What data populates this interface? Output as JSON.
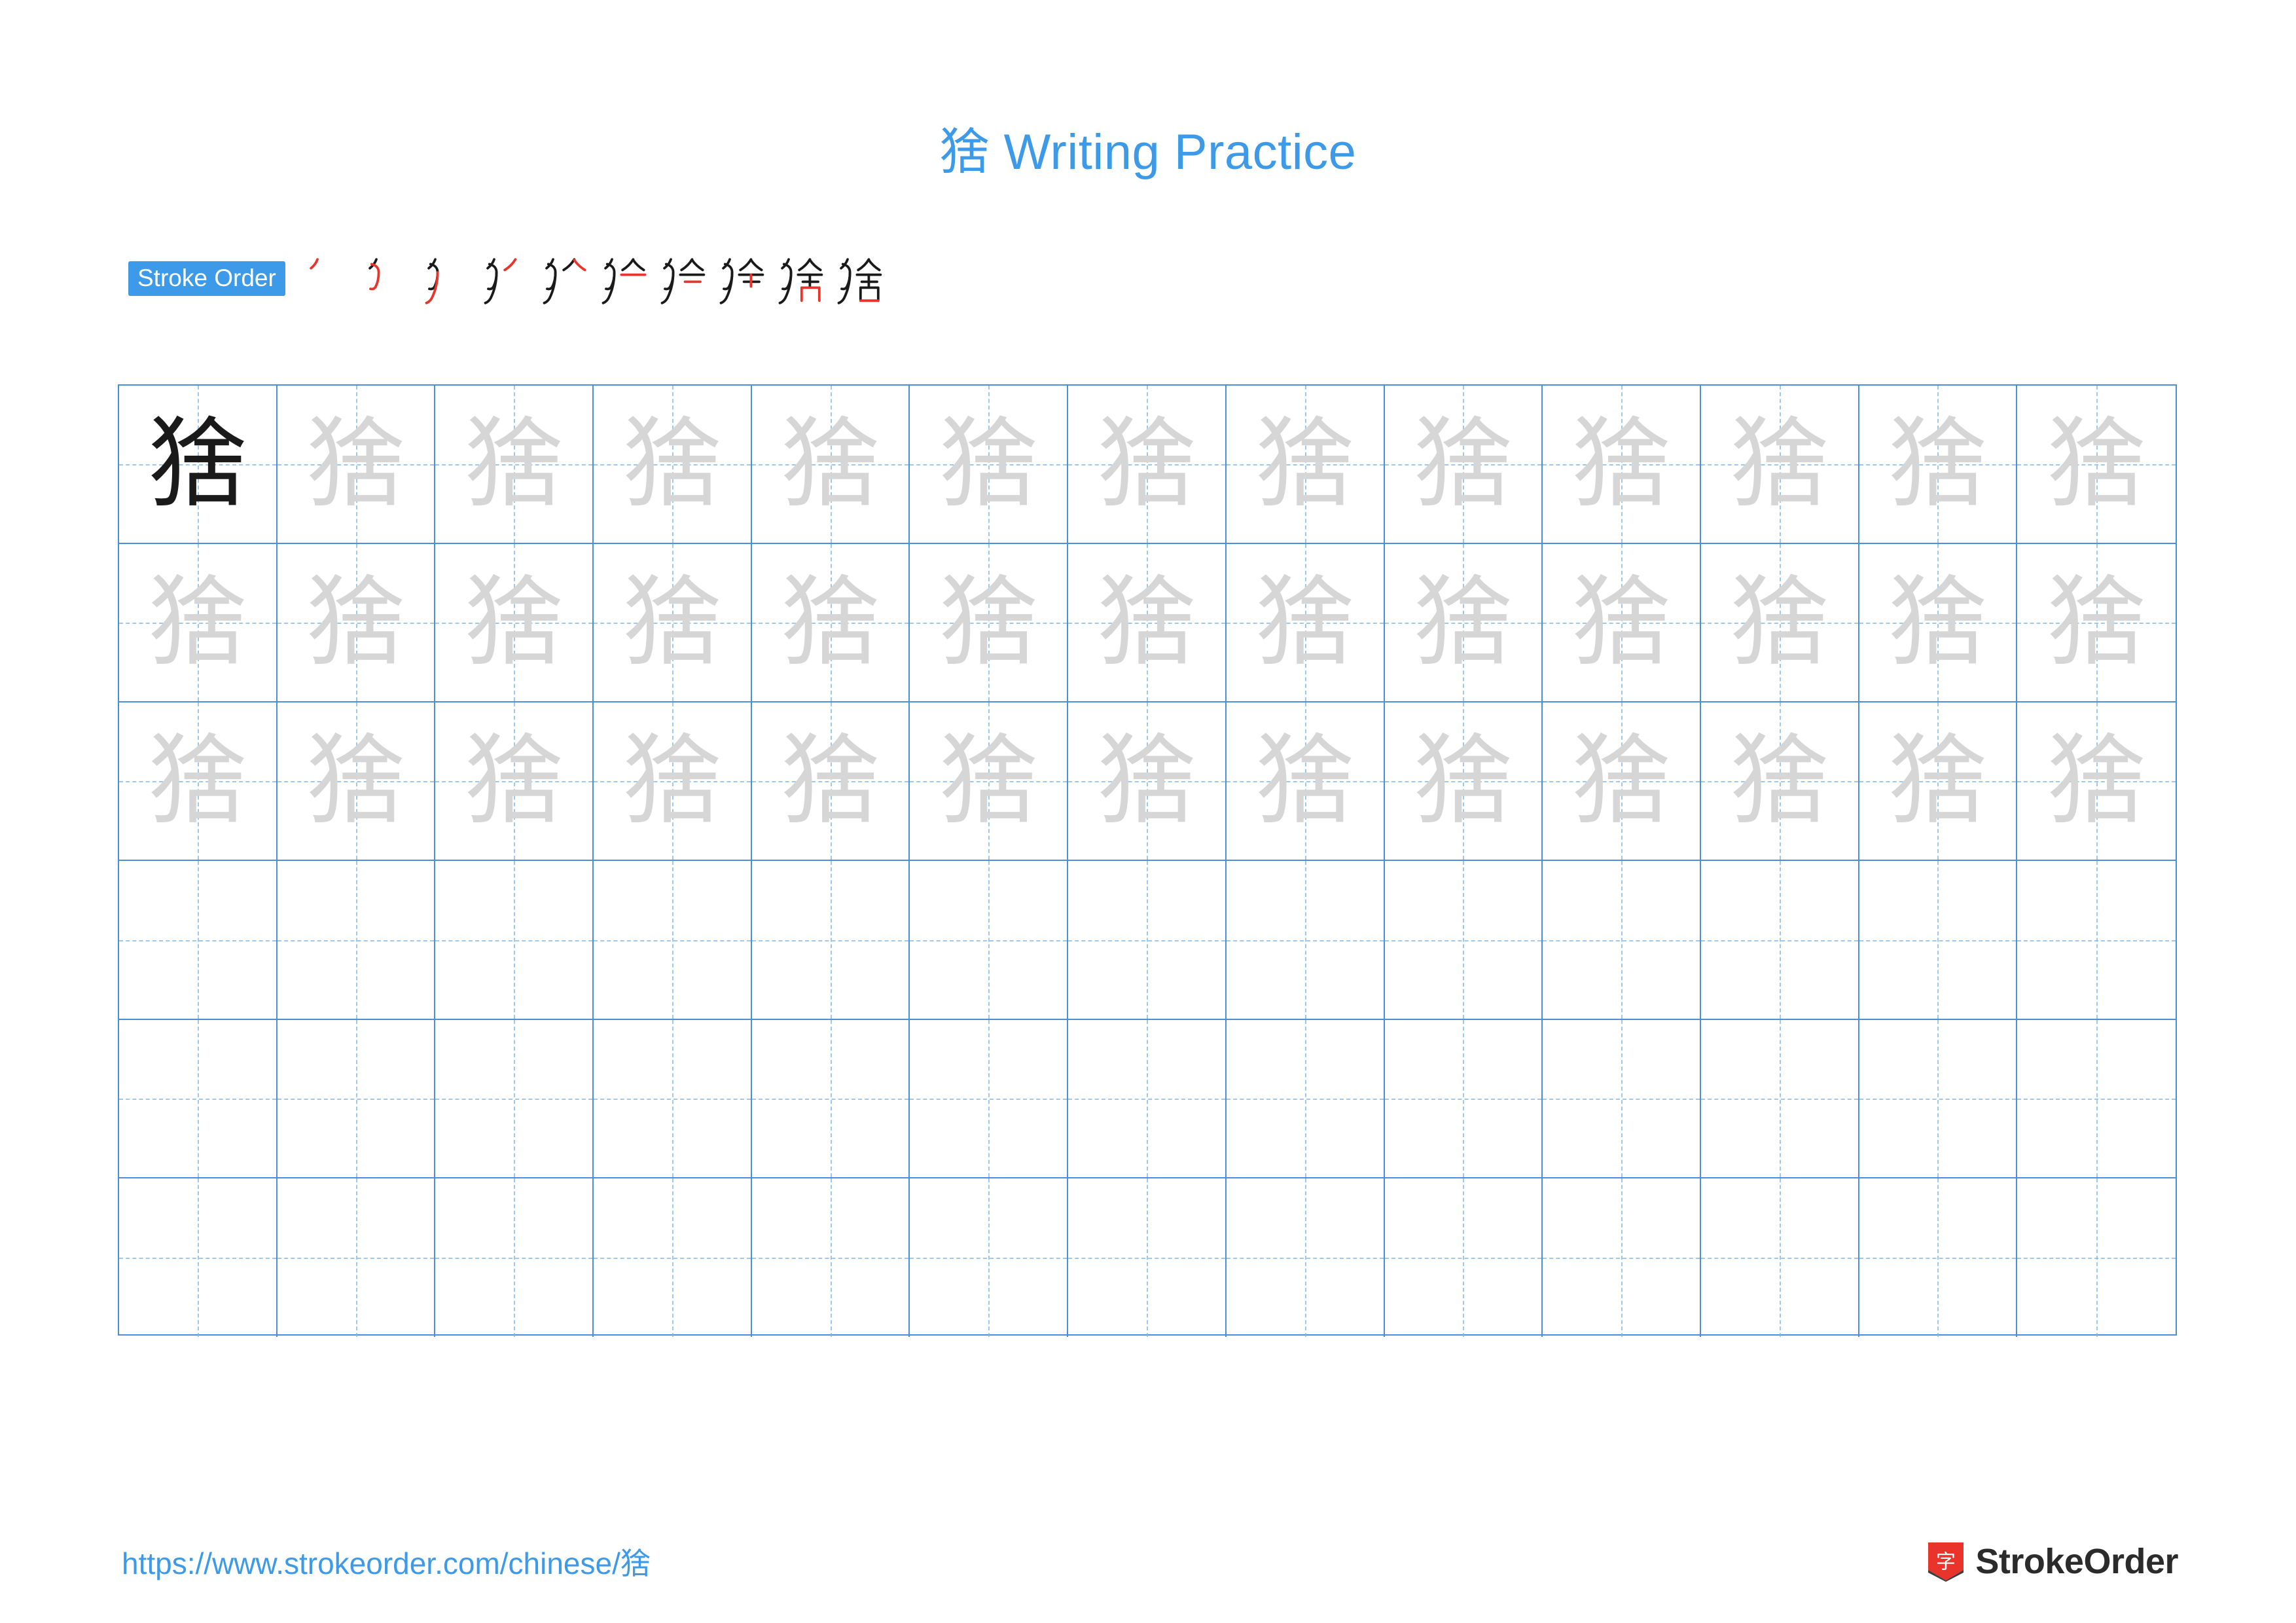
{
  "page": {
    "character": "猞",
    "title_suffix": " Writing Practice",
    "title_full": "猞 Writing Practice"
  },
  "stroke_order": {
    "label": "Stroke Order",
    "steps": [
      {
        "index": 1,
        "strokes_shown": 1,
        "new_stroke": 1
      },
      {
        "index": 2,
        "strokes_shown": 2,
        "new_stroke": 2
      },
      {
        "index": 3,
        "strokes_shown": 3,
        "new_stroke": 3
      },
      {
        "index": 4,
        "strokes_shown": 4,
        "new_stroke": 4
      },
      {
        "index": 5,
        "strokes_shown": 5,
        "new_stroke": 5
      },
      {
        "index": 6,
        "strokes_shown": 6,
        "new_stroke": 6
      },
      {
        "index": 7,
        "strokes_shown": 7,
        "new_stroke": 7
      },
      {
        "index": 8,
        "strokes_shown": 8,
        "new_stroke": 8
      },
      {
        "index": 9,
        "strokes_shown": 9,
        "new_stroke": 9
      },
      {
        "index": 10,
        "strokes_shown": 10,
        "new_stroke": 10
      }
    ],
    "total_strokes": 10
  },
  "practice_grid": {
    "columns": 13,
    "rows": 6,
    "rows_data": [
      {
        "cells": [
          "dark",
          "ghost",
          "ghost",
          "ghost",
          "ghost",
          "ghost",
          "ghost",
          "ghost",
          "ghost",
          "ghost",
          "ghost",
          "ghost",
          "ghost"
        ]
      },
      {
        "cells": [
          "ghost",
          "ghost",
          "ghost",
          "ghost",
          "ghost",
          "ghost",
          "ghost",
          "ghost",
          "ghost",
          "ghost",
          "ghost",
          "ghost",
          "ghost"
        ]
      },
      {
        "cells": [
          "ghost",
          "ghost",
          "ghost",
          "ghost",
          "ghost",
          "ghost",
          "ghost",
          "ghost",
          "ghost",
          "ghost",
          "ghost",
          "ghost",
          "ghost"
        ]
      },
      {
        "cells": [
          "empty",
          "empty",
          "empty",
          "empty",
          "empty",
          "empty",
          "empty",
          "empty",
          "empty",
          "empty",
          "empty",
          "empty",
          "empty"
        ]
      },
      {
        "cells": [
          "empty",
          "empty",
          "empty",
          "empty",
          "empty",
          "empty",
          "empty",
          "empty",
          "empty",
          "empty",
          "empty",
          "empty",
          "empty"
        ]
      },
      {
        "cells": [
          "empty",
          "empty",
          "empty",
          "empty",
          "empty",
          "empty",
          "empty",
          "empty",
          "empty",
          "empty",
          "empty",
          "empty",
          "empty"
        ]
      }
    ]
  },
  "footer": {
    "url": "https://www.strokeorder.com/chinese/猞",
    "brand_name": "StrokeOrder",
    "brand_logo_char": "字"
  },
  "colors": {
    "accent_blue": "#3d9ae8",
    "grid_blue": "#4a90d9",
    "grid_guide_blue": "#7fb8e6",
    "ghost_gray": "#d6d6d6",
    "ink_black": "#1a1a1a",
    "new_stroke_red": "#e8342a",
    "brand_red": "#e8342a"
  }
}
